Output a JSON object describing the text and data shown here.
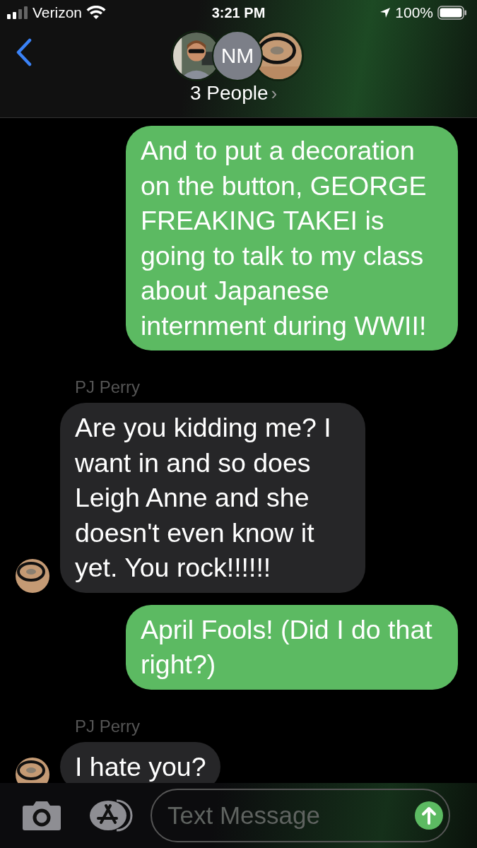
{
  "status_bar": {
    "carrier": "Verizon",
    "time": "3:21 PM",
    "battery": "100%"
  },
  "header": {
    "avatars": [
      {
        "kind": "picture"
      },
      {
        "kind": "initials",
        "initials": "NM"
      },
      {
        "kind": "picture"
      }
    ],
    "title": "3 People",
    "chevron": "›"
  },
  "messages": [
    {
      "kind": "sent",
      "text": "And to put a decoration on the button, GEORGE FREAKING TAKEI is going to talk to my class about Japanese internment during WWII!"
    },
    {
      "kind": "received",
      "sender": "PJ Perry",
      "avatar": true,
      "text": "Are you kidding me? I want in and so does Leigh Anne and she doesn't even know it yet. You rock!!!!!!"
    },
    {
      "kind": "sent",
      "text": "April Fools! (Did I do that right?)"
    },
    {
      "kind": "received",
      "sender": "PJ Perry",
      "avatar": true,
      "text": "I hate you?"
    }
  ],
  "composer": {
    "placeholder": "Text Message"
  }
}
